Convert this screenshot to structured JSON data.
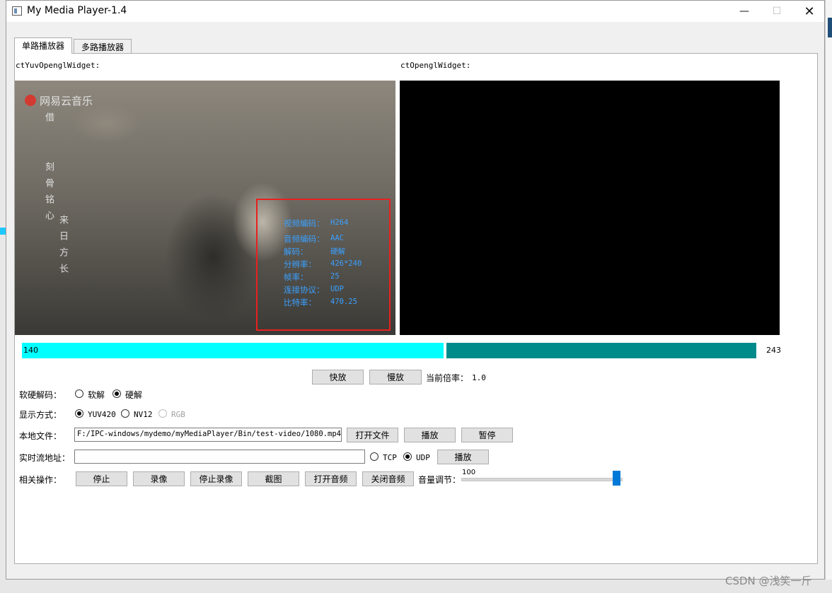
{
  "window": {
    "title": "My Media Player-1.4",
    "minimize": "—",
    "maximize": "☐",
    "close": "✕"
  },
  "tabs": [
    "单路播放器",
    "多路播放器"
  ],
  "widgets": {
    "left_label": "ctYuvOpenglWidget:",
    "right_label": "ctOpenglWidget:"
  },
  "video": {
    "logo_text": "网易云音乐",
    "vertical_text_1": "借",
    "vertical_text_2": "刻骨铭心",
    "vertical_text_3": "来日方长",
    "info": [
      {
        "label": "视频编码：",
        "value": "H264"
      },
      {
        "label": "音频编码：",
        "value": "AAC"
      },
      {
        "label": "解码：",
        "value": "硬解"
      },
      {
        "label": "分辨率：",
        "value": "426*240"
      },
      {
        "label": "帧率：",
        "value": "25"
      },
      {
        "label": "连接协议：",
        "value": "UDP"
      },
      {
        "label": "比特率：",
        "value": "470.25"
      }
    ]
  },
  "progress": {
    "current": "140",
    "total": "243",
    "fraction": 0.576
  },
  "speed": {
    "fast_label": "快放",
    "slow_label": "慢放",
    "rate_label": "当前倍率：",
    "rate_value": "1.0"
  },
  "decode": {
    "label": "软硬解码：",
    "soft": "软解",
    "hard": "硬解",
    "selected": "hard"
  },
  "display": {
    "label": "显示方式：",
    "yuv": "YUV420",
    "nv12": "NV12",
    "rgb": "RGB",
    "selected": "YUV420"
  },
  "local_file": {
    "label": "本地文件：",
    "path": "F:/IPC-windows/mydemo/myMediaPlayer/Bin/test-video/1080.mp4",
    "open_label": "打开文件",
    "play_label": "播放",
    "pause_label": "暂停"
  },
  "stream": {
    "label": "实时流地址：",
    "value": "",
    "tcp": "TCP",
    "udp": "UDP",
    "selected": "UDP",
    "play_label": "播放"
  },
  "ops": {
    "label": "相关操作：",
    "stop": "停止",
    "record": "录像",
    "stop_record": "停止录像",
    "snapshot": "截图",
    "open_audio": "打开音频",
    "close_audio": "关闭音频",
    "volume_label": "音量调节：",
    "volume_value": "100"
  },
  "watermark": "CSDN @浅笑一斤",
  "colors": {
    "progress_played": "#00ffff",
    "progress_rest": "#008b8b",
    "info_text": "#3aa0ff",
    "info_box": "#e8211f",
    "slider": "#0078d7"
  }
}
